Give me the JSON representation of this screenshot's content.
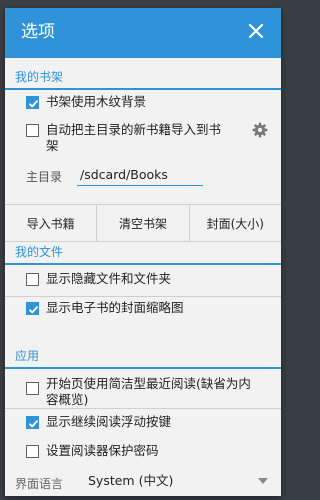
{
  "dialog": {
    "title": "选项",
    "close_icon": "close-icon"
  },
  "bookshelf": {
    "title": "我的书架",
    "options": [
      {
        "label": "书架使用木纹背景",
        "checked": true
      },
      {
        "label": "自动把主目录的新书籍导入到书架",
        "checked": false
      }
    ],
    "settings_icon": "gear-icon",
    "dir_label": "主目录",
    "dir_value": "/sdcard/Books",
    "buttons": [
      "导入书籍",
      "清空书架",
      "封面(大小)"
    ]
  },
  "files": {
    "title": "我的文件",
    "options": [
      {
        "label": "显示隐藏文件和文件夹",
        "checked": false
      },
      {
        "label": "显示电子书的封面缩略图",
        "checked": true
      }
    ]
  },
  "app": {
    "title": "应用",
    "options": [
      {
        "label": "开始页使用简洁型最近阅读(缺省为内容概览)",
        "checked": false
      },
      {
        "label": "显示继续阅读浮动按键",
        "checked": true
      },
      {
        "label": "设置阅读器保护密码",
        "checked": false
      }
    ],
    "language_label": "界面语言",
    "language_value": "System (中文)"
  },
  "colors": {
    "accent": "#2f93d9",
    "background": "#f2f2f2",
    "overlay": "#3a3f45"
  }
}
